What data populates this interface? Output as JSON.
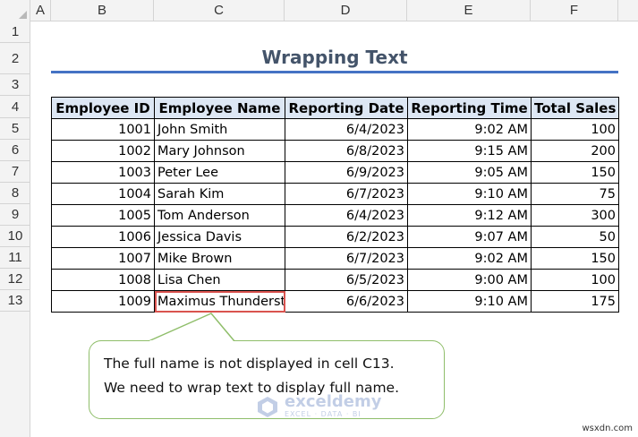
{
  "sheet": {
    "columns": [
      "A",
      "B",
      "C",
      "D",
      "E",
      "F"
    ],
    "rows": [
      "1",
      "2",
      "3",
      "4",
      "5",
      "6",
      "7",
      "8",
      "9",
      "10",
      "11",
      "12",
      "13"
    ]
  },
  "title": "Wrapping Text",
  "table": {
    "headers": [
      "Employee ID",
      "Employee Name",
      "Reporting Date",
      "Reporting Time",
      "Total Sales"
    ],
    "rows": [
      [
        "1001",
        "John Smith",
        "6/4/2023",
        "9:02 AM",
        "100"
      ],
      [
        "1002",
        "Mary Johnson",
        "6/8/2023",
        "9:15 AM",
        "200"
      ],
      [
        "1003",
        "Peter Lee",
        "6/9/2023",
        "9:05 AM",
        "150"
      ],
      [
        "1004",
        "Sarah Kim",
        "6/7/2023",
        "9:10 AM",
        "75"
      ],
      [
        "1005",
        "Tom Anderson",
        "6/4/2023",
        "9:12 AM",
        "300"
      ],
      [
        "1006",
        "Jessica Davis",
        "6/2/2023",
        "9:07 AM",
        "50"
      ],
      [
        "1007",
        "Mike Brown",
        "6/7/2023",
        "9:02 AM",
        "150"
      ],
      [
        "1008",
        "Lisa Chen",
        "6/5/2023",
        "9:00 AM",
        "100"
      ],
      [
        "1009",
        "Maximus Thunderst",
        "6/6/2023",
        "9:10 AM",
        "175"
      ]
    ]
  },
  "callout": {
    "line1": "The full name is not displayed in cell C13.",
    "line2": "We need to wrap text to display full name."
  },
  "watermark": {
    "name": "exceldemy",
    "tagline": "EXCEL · DATA · BI"
  },
  "site": "wsxdn.com",
  "colors": {
    "title": "#44546a",
    "title_rule": "#4472c4",
    "header_fill": "#dde7f4",
    "selection": "#d9534f",
    "callout_border": "#8fbe6a"
  }
}
